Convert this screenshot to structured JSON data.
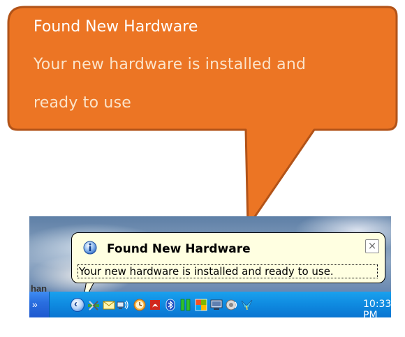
{
  "callout": {
    "title": "Found New Hardware",
    "line1": "Your new hardware is installed and",
    "line2": "ready to use",
    "fill": "#ec7524",
    "stroke": "#b25318"
  },
  "balloon": {
    "title": "Found New Hardware",
    "message": "Your new hardware is installed and ready to use.",
    "close_glyph": "×",
    "background": "#ffffe1"
  },
  "desktop": {
    "partial_text": "han"
  },
  "taskbar": {
    "overflow_glyph": "»",
    "show_hidden_glyph": "‹",
    "clock": "10:33 PM",
    "tray_icons": [
      "safely-remove-hardware-icon",
      "mail-icon",
      "network-icon",
      "clock-app-icon",
      "pdf-icon",
      "bluetooth-icon",
      "green-bars-icon",
      "windows-flag-icon",
      "monitor-icon",
      "speaker-icon",
      "bird-icon"
    ]
  }
}
